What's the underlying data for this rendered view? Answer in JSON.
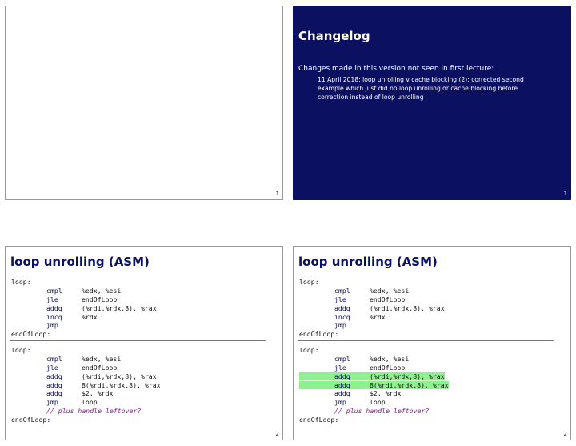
{
  "slides": [
    {
      "page_number": "1"
    },
    {
      "title": "Changelog",
      "intro": "Changes made in this version not seen in first lecture:",
      "entry": "11 April 2018: loop unrolling v cache blocking (2): corrected second example which just did no loop unrolling or cache blocking before correction instead of loop unrolling",
      "page_number": "1"
    },
    {
      "title": "loop unrolling (ASM)",
      "page_number": "2",
      "block1": [
        {
          "label": "loop:"
        },
        {
          "op": "cmpl",
          "arg": "%edx, %esi"
        },
        {
          "op": "jle",
          "arg": "endOfLoop"
        },
        {
          "op": "addq",
          "arg": "(%rdi,%rdx,8), %rax"
        },
        {
          "op": "incq",
          "arg": "%rdx"
        },
        {
          "op": "jmp",
          "arg": ""
        },
        {
          "label": "endOfLoop:"
        }
      ],
      "block2": [
        {
          "label": "loop:"
        },
        {
          "op": "cmpl",
          "arg": "%edx, %esi"
        },
        {
          "op": "jle",
          "arg": "endOfLoop"
        },
        {
          "op": "addq",
          "arg": "(%rdi,%rdx,8), %rax"
        },
        {
          "op": "addq",
          "arg": "8(%rdi,%rdx,8), %rax"
        },
        {
          "op": "addq",
          "arg": "$2, %rdx"
        },
        {
          "op": "jmp",
          "arg": "loop"
        },
        {
          "comment": "// plus handle leftover?"
        },
        {
          "label": "endOfLoop:"
        }
      ]
    },
    {
      "title": "loop unrolling (ASM)",
      "page_number": "2",
      "block1": [
        {
          "label": "loop:"
        },
        {
          "op": "cmpl",
          "arg": "%edx, %esi"
        },
        {
          "op": "jle",
          "arg": "endOfLoop"
        },
        {
          "op": "addq",
          "arg": "(%rdi,%rdx,8), %rax"
        },
        {
          "op": "incq",
          "arg": "%rdx"
        },
        {
          "op": "jmp",
          "arg": ""
        },
        {
          "label": "endOfLoop:"
        }
      ],
      "block2": [
        {
          "label": "loop:"
        },
        {
          "op": "cmpl",
          "arg": "%edx, %esi"
        },
        {
          "op": "jle",
          "arg": "endOfLoop"
        },
        {
          "op": "addq",
          "arg": "(%rdi,%rdx,8), %rax",
          "highlight": true
        },
        {
          "op": "addq",
          "arg": "8(%rdi,%rdx,8), %rax",
          "highlight": true
        },
        {
          "op": "addq",
          "arg": "$2, %rdx"
        },
        {
          "op": "jmp",
          "arg": "loop"
        },
        {
          "comment": "// plus handle leftover?"
        },
        {
          "label": "endOfLoop:"
        }
      ]
    }
  ],
  "colors": {
    "slide_title": "#0b1160",
    "changelog_bg": "#0b1160",
    "highlight": "#8ff08f"
  }
}
